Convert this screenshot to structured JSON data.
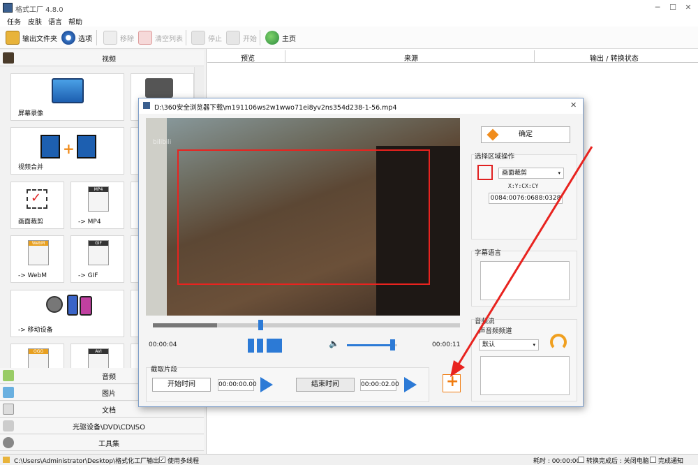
{
  "app": {
    "title": "格式工厂 4.8.0"
  },
  "menu": [
    "任务",
    "皮肤",
    "语言",
    "帮助"
  ],
  "toolbar": {
    "output_folder": "输出文件夹",
    "options": "选项",
    "remove": "移除",
    "clear_list": "清空列表",
    "stop": "停止",
    "start": "开始",
    "home": "主页"
  },
  "categories": {
    "video": "视频",
    "audio": "音频",
    "image": "图片",
    "document": "文档",
    "disc": "光驱设备\\DVD\\CD\\ISO",
    "tools": "工具集"
  },
  "tiles": {
    "screen_record": "屏幕录像",
    "video_merge": "视频合并",
    "crop": "画面裁剪",
    "mp4": "-> MP4",
    "webm": "-> WebM",
    "gif": "-> GIF",
    "mobile": "-> 移动设备",
    "badge_mp4": "MP4",
    "badge_webm": "WebM",
    "badge_gif": "GIF",
    "badge_ogg": "OGG",
    "badge_avi": "AVI"
  },
  "table": {
    "columns": [
      "预览",
      "来源",
      "输出 / 转换状态"
    ]
  },
  "dialog": {
    "title": "D:\\360安全浏览器下载\\m191106ws2w1wwo71ei8yv2ns354d238-1-56.mp4",
    "watermark": "bilibili",
    "confirm": "确定",
    "region_ops": "选择区域操作",
    "region_mode": "画面裁剪",
    "coord_label": "X:Y:CX:CY",
    "coord_value": "0084:0076:0688:0328",
    "subtitle_lang": "字幕语言",
    "audio_stream": "音频流",
    "audio_channel": "声音频频道",
    "audio_default": "默认",
    "time_current": "00:00:04",
    "time_total": "00:00:11",
    "clip_label": "截取片段",
    "start_time_btn": "开始时间",
    "start_time_val": "00:00:00.00",
    "end_time_btn": "结束时间",
    "end_time_val": "00:00:02.00",
    "seek_progress": 0.35,
    "volume_level": 0.9
  },
  "statusbar": {
    "path": "C:\\Users\\Administrator\\Desktop\\格式化工厂输出",
    "multithread": "使用多线程",
    "elapsed": "耗时 : 00:00:00",
    "after_convert": "转换完成后 : 关闭电脑",
    "notify": "完成通知"
  },
  "colors": {
    "accent": "#2c7ad6",
    "annotation": "#e8231f",
    "add": "#f07c10"
  }
}
